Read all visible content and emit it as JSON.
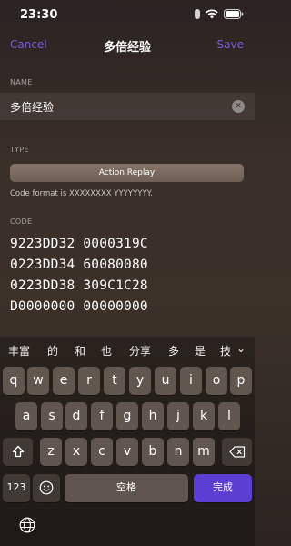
{
  "status": {
    "time": "23:30"
  },
  "nav": {
    "cancel": "Cancel",
    "title": "多倍经验",
    "save": "Save"
  },
  "form": {
    "name_label": "NAME",
    "name_value": "多倍经验",
    "type_label": "TYPE",
    "type_value": "Action Replay",
    "format_note": "Code format is XXXXXXXX YYYYYYYY.",
    "code_label": "CODE",
    "code_lines": [
      "9223DD32 0000319C",
      "0223DD34 60080080",
      "0223DD38 309C1C28",
      "D0000000 00000000"
    ]
  },
  "keyboard": {
    "suggestions": [
      "丰富",
      "的",
      "和",
      "也",
      "分享",
      "多",
      "是",
      "技"
    ],
    "row1": [
      "q",
      "w",
      "e",
      "r",
      "t",
      "y",
      "u",
      "i",
      "o",
      "p"
    ],
    "row2": [
      "a",
      "s",
      "d",
      "f",
      "g",
      "h",
      "j",
      "k",
      "l"
    ],
    "row3": [
      "z",
      "x",
      "c",
      "v",
      "b",
      "n",
      "m"
    ],
    "numbers_key": "123",
    "space_key": "空格",
    "done_key": "完成",
    "icons": [
      "shift-icon",
      "delete-icon",
      "emoji-icon",
      "globe-icon",
      "collapse-icon"
    ]
  }
}
